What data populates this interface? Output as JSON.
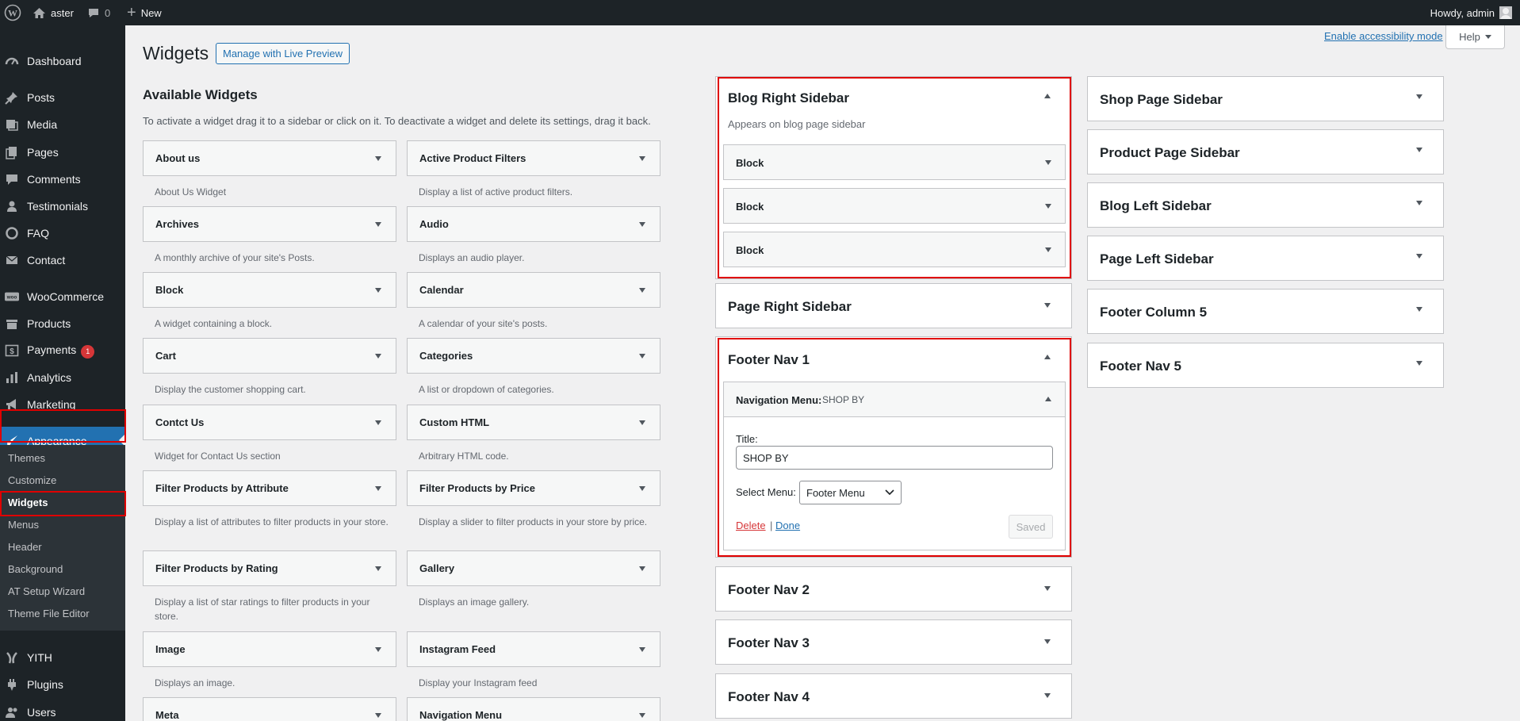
{
  "adminbar": {
    "site_name": "aster",
    "comments_count": "0",
    "new_label": "New",
    "howdy": "Howdy, admin"
  },
  "menu": {
    "dashboard": "Dashboard",
    "posts": "Posts",
    "media": "Media",
    "pages": "Pages",
    "comments": "Comments",
    "testimonials": "Testimonials",
    "faq": "FAQ",
    "contact": "Contact",
    "woocommerce": "WooCommerce",
    "products": "Products",
    "payments": "Payments",
    "payments_badge": "1",
    "analytics": "Analytics",
    "marketing": "Marketing",
    "appearance": "Appearance",
    "yith": "YITH",
    "plugins": "Plugins",
    "users": "Users"
  },
  "submenu": {
    "themes": "Themes",
    "customize": "Customize",
    "widgets": "Widgets",
    "menus": "Menus",
    "header": "Header",
    "background": "Background",
    "setup_wizard": "AT Setup Wizard",
    "theme_file_editor": "Theme File Editor"
  },
  "page": {
    "title": "Widgets",
    "live_preview": "Manage with Live Preview",
    "accessibility": "Enable accessibility mode",
    "help": "Help"
  },
  "available": {
    "heading": "Available Widgets",
    "description": "To activate a widget drag it to a sidebar or click on it. To deactivate a widget and delete its settings, drag it back.",
    "widgets": [
      {
        "name": "About us",
        "desc": "About Us Widget"
      },
      {
        "name": "Active Product Filters",
        "desc": "Display a list of active product filters."
      },
      {
        "name": "Archives",
        "desc": "A monthly archive of your site's Posts."
      },
      {
        "name": "Audio",
        "desc": "Displays an audio player."
      },
      {
        "name": "Block",
        "desc": "A widget containing a block."
      },
      {
        "name": "Calendar",
        "desc": "A calendar of your site's posts."
      },
      {
        "name": "Cart",
        "desc": "Display the customer shopping cart."
      },
      {
        "name": "Categories",
        "desc": "A list or dropdown of categories."
      },
      {
        "name": "Contct Us",
        "desc": "Widget for Contact Us section"
      },
      {
        "name": "Custom HTML",
        "desc": "Arbitrary HTML code."
      },
      {
        "name": "Filter Products by Attribute",
        "desc": "Display a list of attributes to filter products in your store."
      },
      {
        "name": "Filter Products by Price",
        "desc": "Display a slider to filter products in your store by price."
      },
      {
        "name": "Filter Products by Rating",
        "desc": "Display a list of star ratings to filter products in your store."
      },
      {
        "name": "Gallery",
        "desc": "Displays an image gallery."
      },
      {
        "name": "Image",
        "desc": "Displays an image."
      },
      {
        "name": "Instagram Feed",
        "desc": "Display your Instagram feed"
      },
      {
        "name": "Meta",
        "desc": ""
      },
      {
        "name": "Navigation Menu",
        "desc": ""
      }
    ]
  },
  "sidebars_left": {
    "blog_right": {
      "title": "Blog Right Sidebar",
      "desc": "Appears on blog page sidebar",
      "blocks": [
        "Block",
        "Block",
        "Block"
      ]
    },
    "page_right": {
      "title": "Page Right Sidebar"
    },
    "footer_nav1": {
      "title": "Footer Nav 1",
      "widget_label": "Navigation Menu:",
      "widget_sub": "SHOP BY",
      "title_label": "Title:",
      "title_value": "SHOP BY",
      "select_label": "Select Menu:",
      "select_value": "Footer Menu",
      "delete": "Delete",
      "sep": "|",
      "done": "Done",
      "saved": "Saved"
    },
    "footer_nav2": {
      "title": "Footer Nav 2"
    },
    "footer_nav3": {
      "title": "Footer Nav 3"
    },
    "footer_nav4": {
      "title": "Footer Nav 4"
    }
  },
  "sidebars_right": [
    "Shop Page Sidebar",
    "Product Page Sidebar",
    "Blog Left Sidebar",
    "Page Left Sidebar",
    "Footer Column 5",
    "Footer Nav 5"
  ]
}
